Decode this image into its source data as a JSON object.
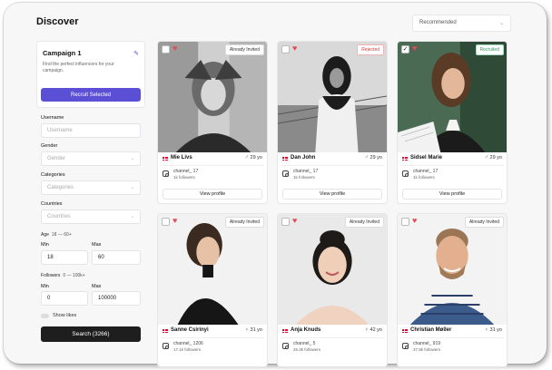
{
  "page": {
    "title": "Discover"
  },
  "sort": {
    "selected": "Recommended"
  },
  "campaign": {
    "name": "Campaign 1",
    "description": "Find the perfect influencers for your campaign.",
    "recruit_label": "Recruit Selected"
  },
  "filters": {
    "username_label": "Username",
    "username_placeholder": "Username",
    "gender_label": "Gender",
    "gender_placeholder": "Gender",
    "categories_label": "Categories",
    "categories_placeholder": "Categories",
    "countries_label": "Countries",
    "countries_placeholder": "Countries",
    "age_label": "Age",
    "age_range": "18 — 60+",
    "age_min_label": "Min",
    "age_min": "18",
    "age_max_label": "Max",
    "age_max": "60",
    "followers_label": "Followers",
    "followers_range": "0 — 100k+",
    "followers_min_label": "Min",
    "followers_min": "0",
    "followers_max_label": "Max",
    "followers_max": "100000",
    "show_likes_label": "Show likes",
    "search_label": "Search (3266)"
  },
  "cards": [
    {
      "name": "Mie Livs",
      "gender": "♂",
      "age": "29 yo",
      "status": "Already Invited",
      "checked": "",
      "channel": "channel_ 17",
      "followers": "1k followers",
      "button": "View profile"
    },
    {
      "name": "Dan John",
      "gender": "♂",
      "age": "29 yo",
      "status": "Rejected",
      "checked": "",
      "channel": "channel_ 17",
      "followers": "1k followers",
      "button": "View profile"
    },
    {
      "name": "Sidsel Marie",
      "gender": "♂",
      "age": "29 yo",
      "status": "Recruited",
      "checked": "✓",
      "channel": "channel_ 17",
      "followers": "1k followers",
      "button": "View profile"
    },
    {
      "name": "Sanne Csirinyi",
      "gender": "♀",
      "age": "31 yo",
      "status": "Already Invited",
      "checked": "",
      "channel": "channel_ 1206",
      "followers": "17.1k followers",
      "button": "View profile"
    },
    {
      "name": "Anja Knuds",
      "gender": "♀",
      "age": "42 yo",
      "status": "Already Invited",
      "checked": "",
      "channel": "channel_ 5",
      "followers": "25.3k followers",
      "button": "View profile"
    },
    {
      "name": "Christian Møller",
      "gender": "♀",
      "age": "31 yo",
      "status": "Already Invited",
      "checked": "",
      "channel": "channel_ 919",
      "followers": "37.8k followers",
      "button": "View profile"
    }
  ],
  "colors": {
    "accent": "#5b4fd6",
    "heart": "#e84a55",
    "rejected": "#d63a3a",
    "recruited": "#1f9d55",
    "search_btn": "#1e1e1e"
  }
}
